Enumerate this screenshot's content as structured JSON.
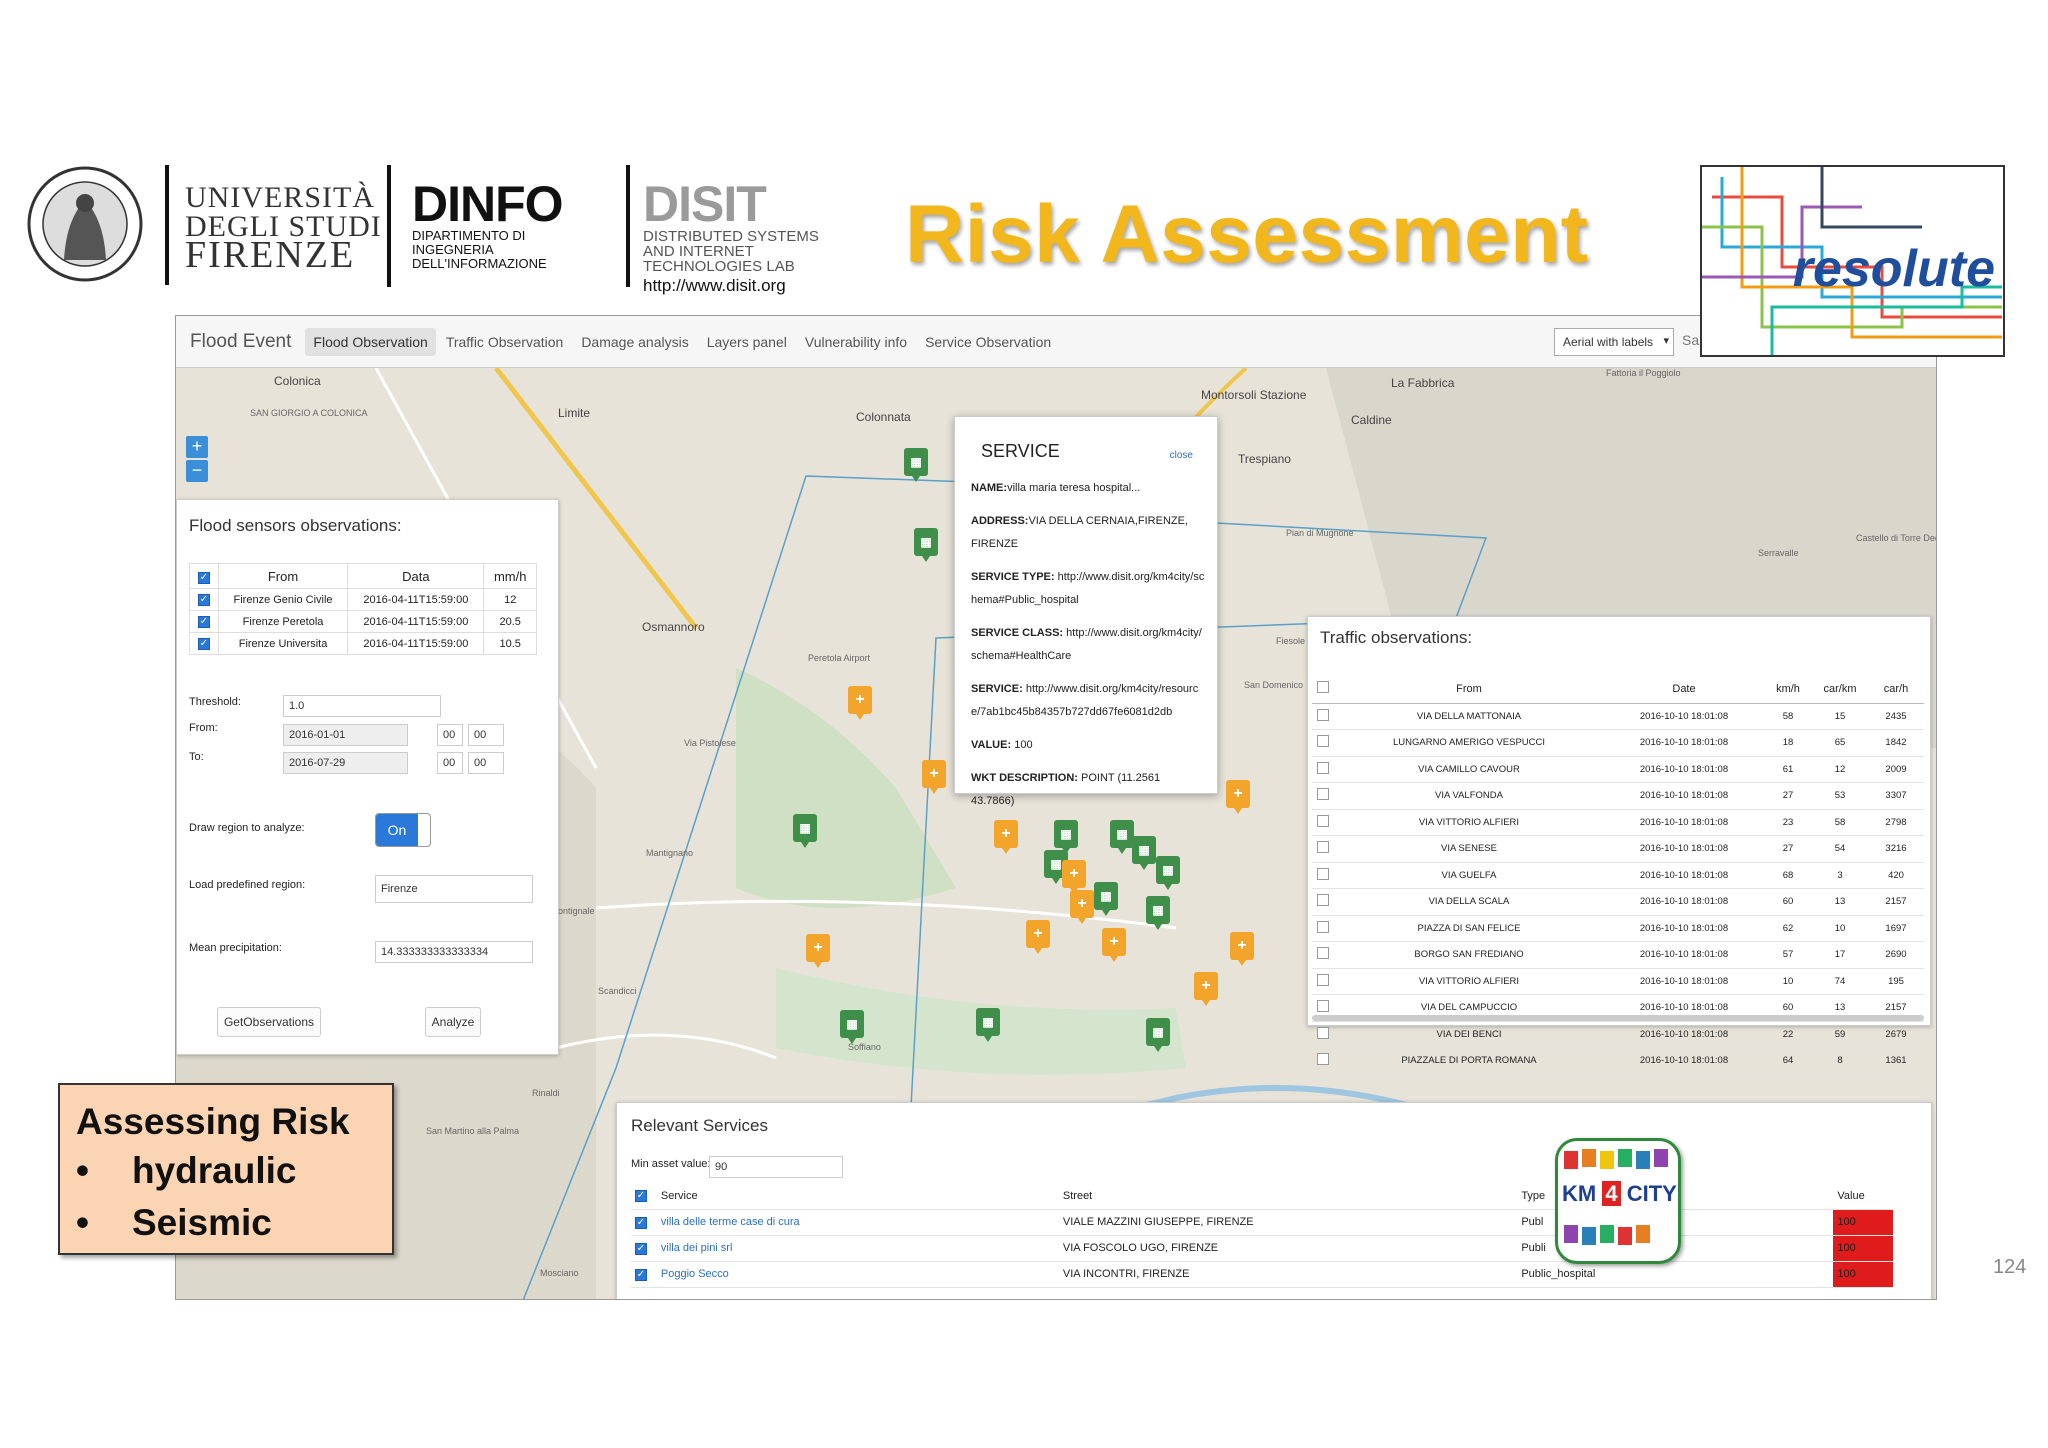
{
  "header": {
    "university_line1": "UNIVERSITÀ",
    "university_line2": "DEGLI STUDI",
    "university_line3": "FIRENZE",
    "dinfo_name": "DINFO",
    "dinfo_sub1": "DIPARTIMENTO DI",
    "dinfo_sub2": "INGEGNERIA",
    "dinfo_sub3": "DELL'INFORMAZIONE",
    "disit_name": "DISIT",
    "disit_sub1": "DISTRIBUTED SYSTEMS",
    "disit_sub2": "AND INTERNET",
    "disit_sub3": "TECHNOLOGIES LAB",
    "disit_url": "http://www.disit.org",
    "title": "Risk Assessment",
    "resolute_logo": "resolute",
    "title_color": "#f1b71c"
  },
  "app": {
    "brand": "Flood Event",
    "tabs": [
      "Flood Observation",
      "Traffic Observation",
      "Damage analysis",
      "Layers panel",
      "Vulnerability info",
      "Service Observation"
    ],
    "active_tab": "Flood Observation",
    "layer_select": "Aerial with labels",
    "save_partial": "Sa",
    "zoom_in": "+",
    "zoom_out": "−"
  },
  "map_labels": {
    "colonica": "Colonica",
    "san_giorgio": "SAN GIORGIO A COLONICA",
    "limite": "Limite",
    "colonnata": "Colonnata",
    "montorsoli": "Montorsoli Stazione",
    "la_fabbrica": "La Fabbrica",
    "caldine": "Caldine",
    "trespiano": "Trespiano",
    "fattoria": "Fattoria il Poggiolo",
    "pian_di_mugnone": "Pian di Mugnone",
    "serravalle": "Serravalle",
    "castello": "Castello di Torre Decima",
    "osmannoro": "Osmannoro",
    "peretola": "Peretola Airport",
    "via_pistoiese": "Via Pistoiese",
    "fiesole": "Fiesole",
    "san_domenico": "San Domenico",
    "mantignano": "Mantignano",
    "scandicci": "Scandicci",
    "soffiano": "Soffiano",
    "rinaldi": "Rinaldi",
    "san_martino": "San Martino alla Palma",
    "mosciano": "Mosciano",
    "ontignale": "ontignale"
  },
  "flood_panel": {
    "title": "Flood sensors observations:",
    "headers": [
      "From",
      "Data",
      "mm/h"
    ],
    "rows": [
      {
        "from": "Firenze Genio Civile",
        "data": "2016-04-11T15:59:00",
        "mmh": "12"
      },
      {
        "from": "Firenze Peretola",
        "data": "2016-04-11T15:59:00",
        "mmh": "20.5"
      },
      {
        "from": "Firenze Universita",
        "data": "2016-04-11T15:59:00",
        "mmh": "10.5"
      }
    ],
    "threshold_label": "Threshold:",
    "threshold_value": "1.0",
    "from_label": "From:",
    "from_value": "2016-01-01",
    "from_h": "00",
    "from_m": "00",
    "to_label": "To:",
    "to_value": "2016-07-29",
    "to_h": "00",
    "to_m": "00",
    "draw_label": "Draw region to analyze:",
    "draw_toggle": "On",
    "load_label": "Load predefined region:",
    "load_value": "Firenze",
    "mean_label": "Mean precipitation:",
    "mean_value": "14.333333333333334",
    "get_button": "GetObservations",
    "analyze_button": "Analyze"
  },
  "service_popup": {
    "title": "SERVICE",
    "close": "close",
    "name_label": "NAME:",
    "name_value": "villa maria teresa hospital...",
    "address_label": "ADDRESS:",
    "address_value": "VIA DELLA CERNAIA,FIRENZE, FIRENZE",
    "type_label": "SERVICE TYPE:",
    "type_value": "http://www.disit.org/km4city/schema#Public_hospital",
    "class_label": "SERVICE CLASS:",
    "class_value": "http://www.disit.org/km4city/schema#HealthCare",
    "service_label": "SERVICE:",
    "service_value": "http://www.disit.org/km4city/resource/7ab1bc45b84357b727dd67fe6081d2db",
    "value_label": "VALUE:",
    "value_value": "100",
    "wkt_label": "WKT DESCRIPTION:",
    "wkt_value": "POINT (11.2561 43.7866)"
  },
  "traffic_panel": {
    "title": "Traffic observations:",
    "headers": [
      "From",
      "Date",
      "km/h",
      "car/km",
      "car/h"
    ],
    "rows": [
      [
        "VIA DELLA MATTONAIA",
        "2016-10-10 18:01:08",
        "58",
        "15",
        "2435"
      ],
      [
        "LUNGARNO AMERIGO VESPUCCI",
        "2016-10-10 18:01:08",
        "18",
        "65",
        "1842"
      ],
      [
        "VIA CAMILLO CAVOUR",
        "2016-10-10 18:01:08",
        "61",
        "12",
        "2009"
      ],
      [
        "VIA VALFONDA",
        "2016-10-10 18:01:08",
        "27",
        "53",
        "3307"
      ],
      [
        "VIA VITTORIO ALFIERI",
        "2016-10-10 18:01:08",
        "23",
        "58",
        "2798"
      ],
      [
        "VIA SENESE",
        "2016-10-10 18:01:08",
        "27",
        "54",
        "3216"
      ],
      [
        "VIA GUELFA",
        "2016-10-10 18:01:08",
        "68",
        "3",
        "420"
      ],
      [
        "VIA DELLA SCALA",
        "2016-10-10 18:01:08",
        "60",
        "13",
        "2157"
      ],
      [
        "PIAZZA DI SAN FELICE",
        "2016-10-10 18:01:08",
        "62",
        "10",
        "1697"
      ],
      [
        "BORGO SAN FREDIANO",
        "2016-10-10 18:01:08",
        "57",
        "17",
        "2690"
      ],
      [
        "VIA VITTORIO ALFIERI",
        "2016-10-10 18:01:08",
        "10",
        "74",
        "195"
      ],
      [
        "VIA DEL CAMPUCCIO",
        "2016-10-10 18:01:08",
        "60",
        "13",
        "2157"
      ],
      [
        "VIA DEI BENCI",
        "2016-10-10 18:01:08",
        "22",
        "59",
        "2679"
      ],
      [
        "PIAZZALE DI PORTA ROMANA",
        "2016-10-10 18:01:08",
        "64",
        "8",
        "1361"
      ]
    ]
  },
  "services_panel": {
    "title": "Relevant Services",
    "min_label": "Min asset value:",
    "min_value": "90",
    "headers": [
      "Service",
      "Street",
      "Type",
      "Value"
    ],
    "rows": [
      [
        "villa delle terme case di cura",
        "VIALE MAZZINI GIUSEPPE, FIRENZE",
        "Publ",
        "100"
      ],
      [
        "villa dei pini srl",
        "VIA FOSCOLO UGO, FIRENZE",
        "Publi",
        "100"
      ],
      [
        "Poggio Secco",
        "VIA INCONTRI, FIRENZE",
        "Public_hospital",
        "100"
      ]
    ],
    "value_color": "#e01b1b"
  },
  "callout": {
    "heading": "Assessing Risk",
    "items": [
      "hydraulic",
      "Seismic"
    ],
    "bullet": "•"
  },
  "km4city": {
    "km": "KM",
    "four": "4",
    "city": "CITY"
  },
  "page_number": "124"
}
